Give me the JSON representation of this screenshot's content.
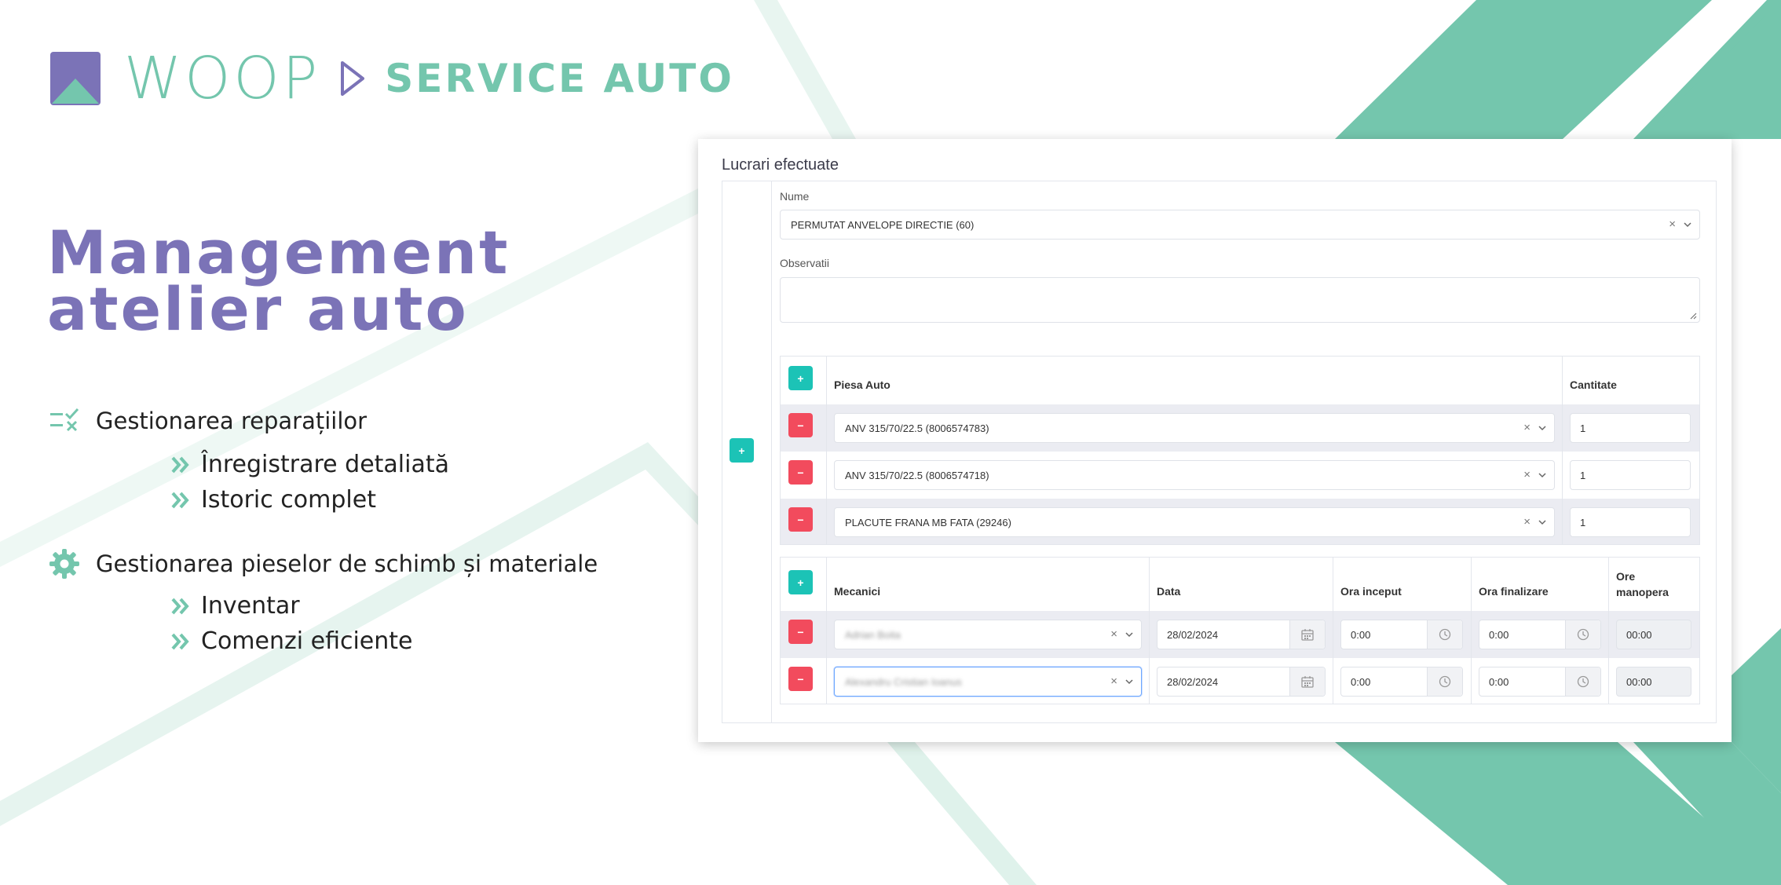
{
  "brand": {
    "wordmark": "WOOP",
    "subtitle": "SERVICE AUTO",
    "colors": {
      "green": "#74c6ad",
      "purple": "#7b73b7"
    }
  },
  "hero": {
    "line1": "Management",
    "line2": "atelier auto"
  },
  "features": [
    {
      "icon": "checklist-icon",
      "label": "Gestionarea reparațiilor",
      "items": [
        "Înregistrare detaliată",
        "Istoric complet"
      ]
    },
    {
      "icon": "gear-icon",
      "label": "Gestionarea pieselor de schimb și materiale",
      "items": [
        "Inventar",
        "Comenzi eficiente"
      ]
    }
  ],
  "form": {
    "title": "Lucrari efectuate",
    "side_add_label": "+",
    "nume": {
      "label": "Nume",
      "value": "PERMUTAT ANVELOPE DIRECTIE (60)"
    },
    "observatii": {
      "label": "Observatii",
      "value": ""
    },
    "add_label": "+",
    "remove_label": "−",
    "parts": {
      "headers": {
        "part": "Piesa Auto",
        "qty": "Cantitate"
      },
      "rows": [
        {
          "part": "ANV 315/70/22.5 (8006574783)",
          "qty": "1"
        },
        {
          "part": "ANV 315/70/22.5 (8006574718)",
          "qty": "1"
        },
        {
          "part": "PLACUTE FRANA MB FATA (29246)",
          "qty": "1"
        }
      ]
    },
    "mechanics": {
      "headers": {
        "mechanic": "Mecanici",
        "date": "Data",
        "start": "Ora inceput",
        "end": "Ora finalizare",
        "hours_line1": "Ore",
        "hours_line2": "manopera"
      },
      "rows": [
        {
          "mechanic": "Adrian Boita",
          "date": "28/02/2024",
          "start": "0:00",
          "end": "0:00",
          "hours": "00:00"
        },
        {
          "mechanic": "Alexandru Cristian Ioanus",
          "date": "28/02/2024",
          "start": "0:00",
          "end": "0:00",
          "hours": "00:00"
        }
      ]
    }
  }
}
